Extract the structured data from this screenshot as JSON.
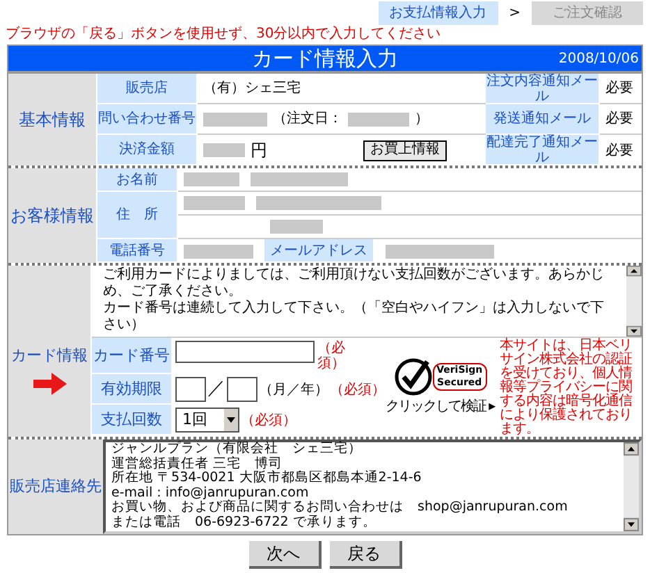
{
  "steps": [
    {
      "label": "お支払情報入力",
      "selected": true
    },
    {
      "label": "ご注文確認",
      "selected": false
    }
  ],
  "step_separator": ">",
  "notice": "ブラウザの「戻る」ボタンを使用せず、30分以内で入力してください",
  "title": "カード情報入力",
  "date": "2008/10/06",
  "basic_info": {
    "heading": "基本情報",
    "shop_label": "販売店",
    "shop_value": "（有）シェ三宅",
    "inquiry_label": "問い合わせ番号",
    "order_date_prefix": "（注文日：",
    "order_date_suffix": "）",
    "amount_label": "決済金額",
    "currency": "円",
    "purchase_button": "お買上情報",
    "mails": [
      {
        "label": "注文内容通知メール",
        "value": "必要"
      },
      {
        "label": "発送通知メール",
        "value": "必要"
      },
      {
        "label": "配達完了通知メール",
        "value": "必要"
      }
    ]
  },
  "customer_info": {
    "heading": "お客様情報",
    "name_label": "お名前",
    "address_label": "住　所",
    "phone_label": "電話番号",
    "email_label": "メールアドレス"
  },
  "card_info": {
    "heading": "カード情報",
    "notes": [
      "ご利用カードによりましては、ご利用頂けない支払回数がございます。あらかじめ、ご了承ください。",
      "カード番号は連続して入力して下さい。（「空白やハイフン」は入力しないで下さい）"
    ],
    "number_label": "カード番号",
    "number_required": "（必須）",
    "expiry_label": "有効期限",
    "expiry_separator": "／",
    "expiry_hint": "（月／年）",
    "expiry_required": "（必須）",
    "installments_label": "支払回数",
    "installments_value": "1回",
    "installments_required": "（必須）",
    "seal": {
      "brand": "VeriSign",
      "sub": "Secured",
      "caption": "クリックして検証 ▸"
    },
    "security_text": "本サイトは、日本ベリサイン株式会社の認証を受けており、個人情報等プライバシーに関する内容は暗号化通信により保護されております。"
  },
  "vendor_contact": {
    "heading": "販売店連絡先",
    "lines": [
      "ジャンルプラン（有限会社　シェ三宅）",
      "運営総括責任者 三宅　博司",
      "所在地 〒534-0021 大阪市都島区都島本通2-14-6",
      "e-mail :  info@janrupuran.com",
      "お買い物、および商品に関するお問い合わせは　shop@janrupuran.com",
      "または電話　06-6923-6722 で承ります。"
    ]
  },
  "buttons": [
    "次へ",
    "戻る"
  ]
}
